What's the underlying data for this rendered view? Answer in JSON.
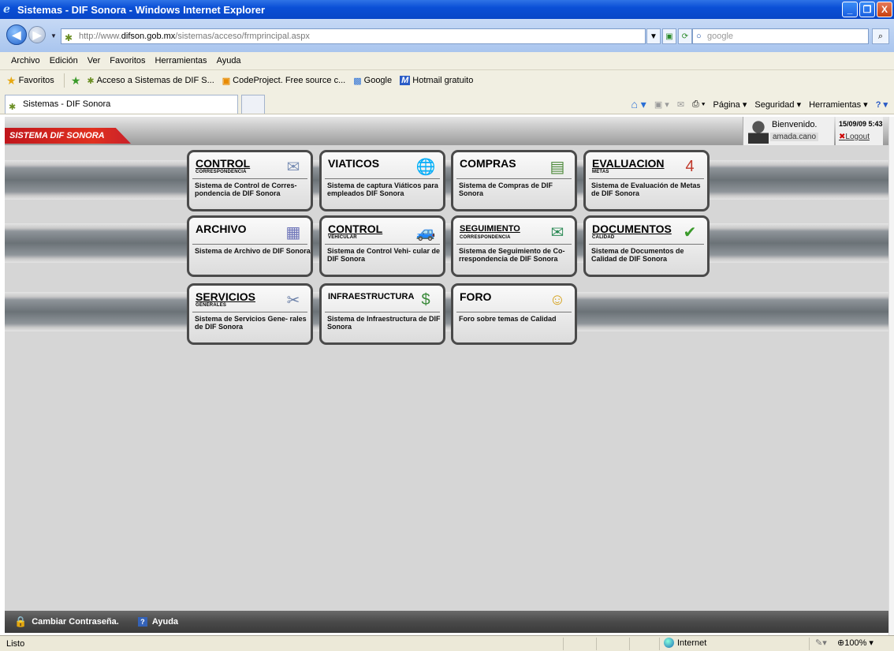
{
  "window": {
    "title": "Sistemas - DIF Sonora - Windows Internet Explorer",
    "controls": [
      "_",
      "❐",
      "X"
    ]
  },
  "address_bar": {
    "url_prefix": "http://www.",
    "url_domain": "difson.gob.mx",
    "url_rest": "/sistemas/acceso/frmprincipal.aspx",
    "search_placeholder": "google"
  },
  "menu": [
    "Archivo",
    "Edición",
    "Ver",
    "Favoritos",
    "Herramientas",
    "Ayuda"
  ],
  "favorites": {
    "label": "Favoritos",
    "links": [
      "Acceso a Sistemas de DIF S...",
      "CodeProject. Free source c...",
      "Google",
      "Hotmail gratuito"
    ]
  },
  "tabs": {
    "active": "Sistemas - DIF Sonora",
    "commands": [
      "Página",
      "Seguridad",
      "Herramientas"
    ]
  },
  "app": {
    "brand": "SISTEMA DIF SONORA",
    "welcome": "Bienvenido.",
    "username": "amada.cano",
    "datetime": "15/09/09 5:43",
    "logout": "Logout"
  },
  "tiles": [
    {
      "title": "CONTROL",
      "subtitle": "CORRESPONDENCIA",
      "desc": "Sistema de Control de Corres- pondencia de DIF Sonora",
      "icon": "envelope-icon",
      "glyph": "✉",
      "color": "#7a8fb5"
    },
    {
      "title": "VIATICOS",
      "subtitle": "",
      "desc": "Sistema de captura Viáticos para empleados DIF Sonora",
      "icon": "globe-icon",
      "glyph": "🌐",
      "color": "#1d4fa8"
    },
    {
      "title": "COMPRAS",
      "subtitle": "",
      "desc": "Sistema de Compras de DIF Sonora",
      "icon": "calculator-icon",
      "glyph": "▤",
      "color": "#4c8a3a"
    },
    {
      "title": "EVALUACION",
      "subtitle": "METAS",
      "desc": "Sistema de Evaluación de Metas de DIF Sonora",
      "icon": "calendar-icon",
      "glyph": "4",
      "color": "#c0392b"
    },
    {
      "title": "ARCHIVO",
      "subtitle": "",
      "desc": "Sistema de Archivo de DIF Sonora",
      "icon": "file-cabinet-icon",
      "glyph": "▦",
      "color": "#6b72b8"
    },
    {
      "title": "CONTROL",
      "subtitle": "VEHICULAR",
      "desc": "Sistema de Control Vehi- cular de DIF Sonora",
      "icon": "car-icon",
      "glyph": "🚙",
      "color": "#1d4fa8"
    },
    {
      "title": "SEGUIMIENTO",
      "subtitle": "CORRESPONDENCIA",
      "desc": "Sistema de Seguimiento de Co- rrespondencia de DIF Sonora",
      "icon": "mail-globe-icon",
      "glyph": "✉",
      "color": "#2e8b57"
    },
    {
      "title": "DOCUMENTOS",
      "subtitle": "CALIDAD",
      "desc": "Sistema de Documentos de Calidad de DIF Sonora",
      "icon": "document-check-icon",
      "glyph": "✔",
      "color": "#3a9a2a"
    },
    {
      "title": "SERVICIOS",
      "subtitle": "GENERALES",
      "desc": "Sistema de Servicios Gene- rales de DIF Sonora",
      "icon": "tools-icon",
      "glyph": "✂",
      "color": "#6a7fa8"
    },
    {
      "title": "INFRAESTRUCTURA",
      "subtitle": "",
      "desc": "Sistema de Infraestructura de DIF Sonora",
      "icon": "money-icon",
      "glyph": "$",
      "color": "#3a8a3a"
    },
    {
      "title": "FORO",
      "subtitle": "",
      "desc": "Foro sobre temas de Calidad",
      "icon": "chat-person-icon",
      "glyph": "☺",
      "color": "#d4a017"
    }
  ],
  "footer": {
    "change_password": "Cambiar Contraseña.",
    "help": "Ayuda"
  },
  "status": {
    "text": "Listo",
    "zone": "Internet",
    "zoom": "100%"
  }
}
